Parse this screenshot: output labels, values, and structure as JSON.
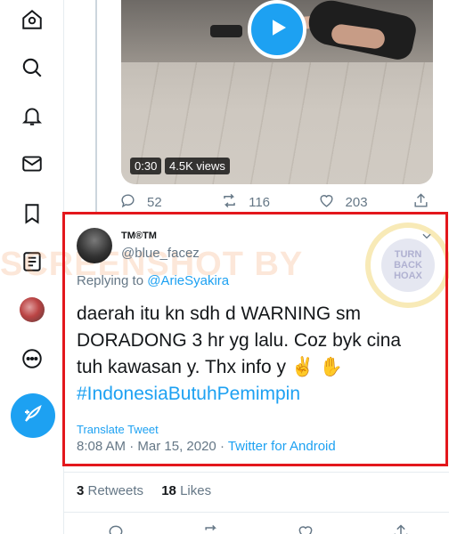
{
  "sidebar": {
    "icons": [
      "home-icon",
      "explore-icon",
      "notifications-icon",
      "messages-icon",
      "bookmarks-icon",
      "lists-icon",
      "profile-avatar",
      "more-icon"
    ],
    "compose_icon": "feather-compose-icon"
  },
  "video": {
    "duration": "0:30",
    "views": "4.5K views"
  },
  "parent_actions": {
    "replies": "52",
    "retweets": "116",
    "likes": "203"
  },
  "watermark": {
    "text": "SCREENSHOT BY",
    "seal_lines": [
      "TURN",
      "BACK",
      "HOAX"
    ]
  },
  "tweet": {
    "display_name": "TM®TM",
    "handle": "@blue_facez",
    "replying_prefix": "Replying to",
    "replying_to": "@ArieSyakira",
    "line1": "daerah itu kn sdh d WARNING sm",
    "line2": "DORADONG 3 hr yg lalu. Coz byk cina",
    "line3": "tuh kawasan y. Thx info y ✌️ ✋",
    "hashtag": "#IndonesiaButuhPemimpin",
    "translate": "Translate Tweet",
    "time": "8:08 AM",
    "separator": " · ",
    "date": "Mar 15, 2020",
    "source": "Twitter for Android"
  },
  "stats": {
    "retweets_count": "3",
    "retweets_label": " Retweets",
    "likes_count": "18",
    "likes_label": " Likes"
  },
  "colors": {
    "accent": "#1da1f2",
    "highlight_border": "#e3171c",
    "muted": "#657786"
  }
}
